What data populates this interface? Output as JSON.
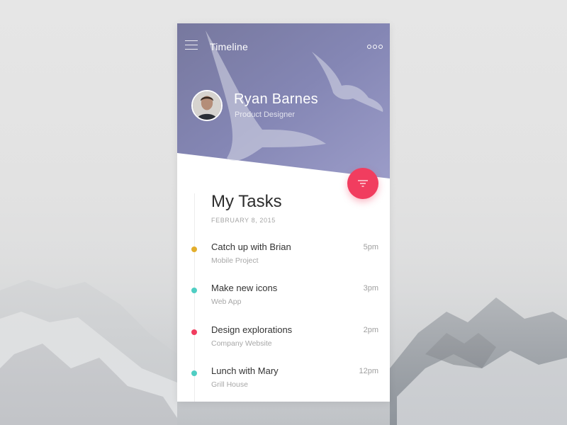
{
  "header": {
    "title": "Timeline",
    "menu_icon": "hamburger-menu-icon",
    "more_icon": "more-dots-icon"
  },
  "profile": {
    "name": "Ryan Barnes",
    "role": "Product Designer"
  },
  "fab": {
    "icon": "filter-icon",
    "color": "#f13d5f"
  },
  "tasks_section": {
    "title": "My Tasks",
    "date": "FEBRUARY 8, 2015"
  },
  "tasks": [
    {
      "title": "Catch up with Brian",
      "project": "Mobile Project",
      "time": "5pm",
      "color": "#e3ae2c"
    },
    {
      "title": "Make new icons",
      "project": "Web App",
      "time": "3pm",
      "color": "#4fcec3"
    },
    {
      "title": "Design explorations",
      "project": "Company Website",
      "time": "2pm",
      "color": "#f13d5f"
    },
    {
      "title": "Lunch with Mary",
      "project": "Grill House",
      "time": "12pm",
      "color": "#4fcec3"
    }
  ],
  "colors": {
    "header_gradient_start": "#6f6fa6",
    "header_gradient_end": "#9a9ac6",
    "accent": "#f13d5f"
  }
}
